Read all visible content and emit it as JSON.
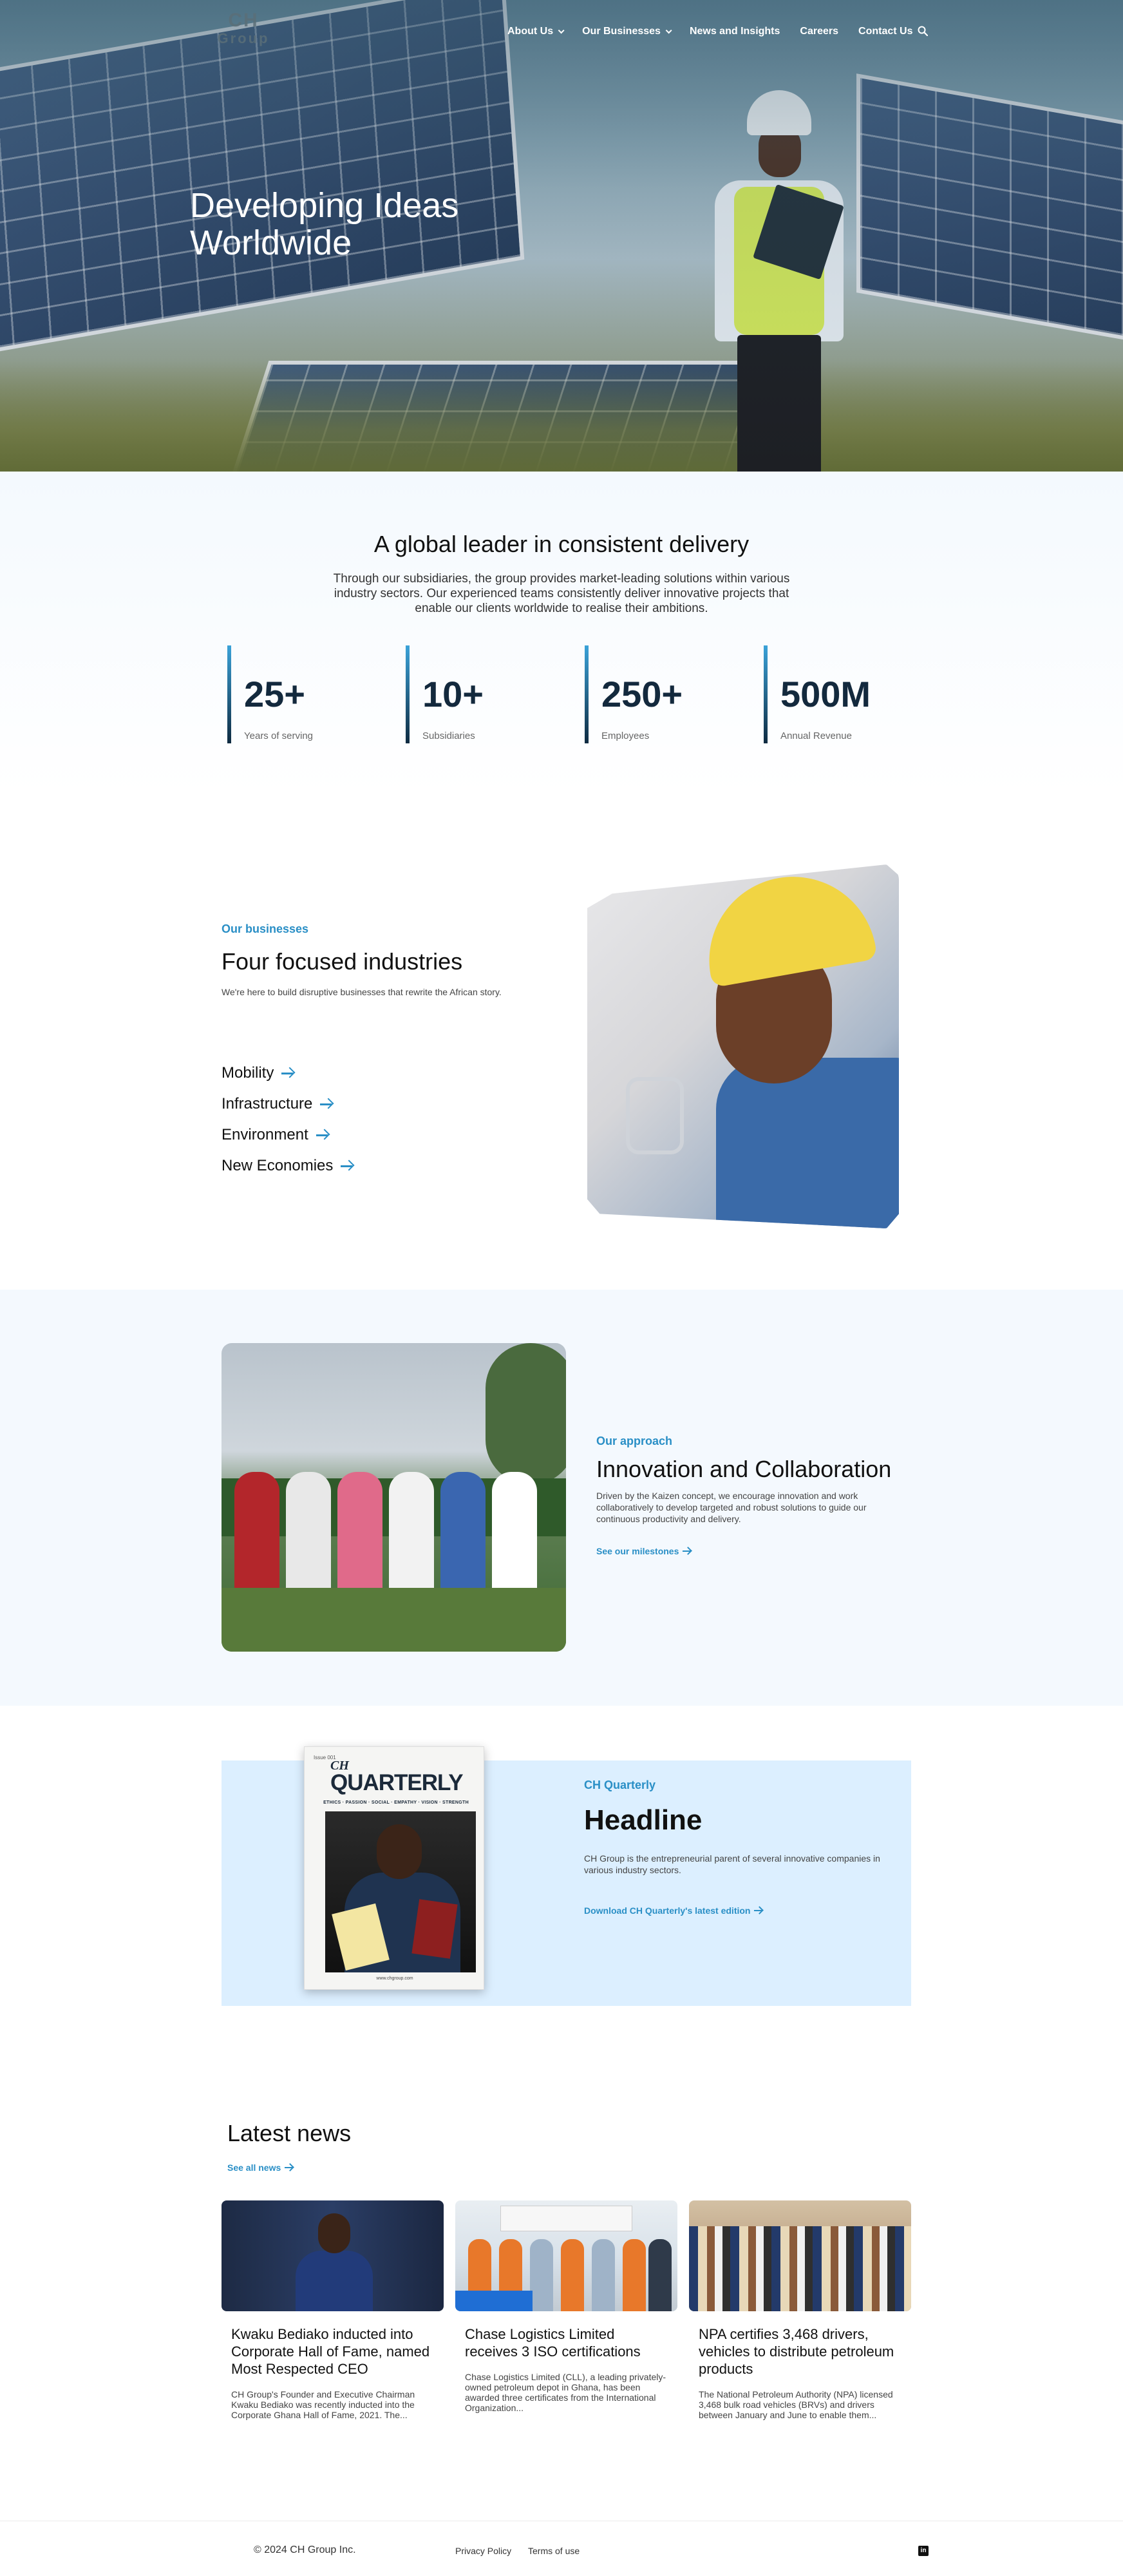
{
  "brand": {
    "logo_line1": "CH",
    "logo_line2": "Group"
  },
  "nav": {
    "items": [
      {
        "label": "About Us",
        "has_dropdown": true
      },
      {
        "label": "Our Businesses",
        "has_dropdown": true
      },
      {
        "label": "News and Insights",
        "has_dropdown": false
      },
      {
        "label": "Careers",
        "has_dropdown": false
      },
      {
        "label": "Contact Us",
        "has_dropdown": false
      }
    ],
    "search_icon": "search-icon"
  },
  "hero": {
    "title_line1": "Developing Ideas",
    "title_line2": "Worldwide"
  },
  "stats": {
    "title": "A global leader in consistent delivery",
    "lead": "Through our subsidiaries, the group provides market-leading solutions within various industry sectors. Our experienced teams consistently deliver innovative projects that enable our clients worldwide to realise their ambitions.",
    "items": [
      {
        "value": "25+",
        "label": "Years of serving"
      },
      {
        "value": "10+",
        "label": "Subsidiaries"
      },
      {
        "value": "250+",
        "label": "Employees"
      },
      {
        "value": "500M",
        "label": "Annual Revenue"
      }
    ]
  },
  "businesses": {
    "eyebrow": "Our businesses",
    "title": "Four focused industries",
    "subtitle": "We're here to build disruptive businesses that rewrite the African story.",
    "links": [
      "Mobility",
      "Infrastructure",
      "Environment",
      "New Economies"
    ]
  },
  "approach": {
    "eyebrow": "Our approach",
    "title": "Innovation and Collaboration",
    "subtitle": "Driven by the Kaizen concept, we encourage innovation and work collaboratively to develop targeted and robust solutions to guide our continuous productivity and delivery.",
    "cta": "See our milestones"
  },
  "quarterly": {
    "eyebrow": "CH Quarterly",
    "title": "Headline",
    "subtitle": "CH Group is the entrepreneurial parent of several innovative companies in various industry sectors.",
    "cta": "Download CH Quarterly's latest edition",
    "magazine": {
      "issue": "Issue 001",
      "brand": "CH",
      "name": "QUARTERLY",
      "tagline": "ETHICS · PASSION · SOCIAL · EMPATHY · VISION · STRENGTH",
      "footer": "www.chgroup.com"
    }
  },
  "news": {
    "title": "Latest news",
    "see_all": "See all news",
    "cards": [
      {
        "title": "Kwaku Bediako inducted into Corporate Hall of Fame, named Most Respected CEO",
        "excerpt": "CH Group's Founder and Executive Chairman Kwaku Bediako was recently inducted into the Corporate Ghana Hall of Fame, 2021. The..."
      },
      {
        "title": "Chase Logistics Limited receives 3 ISO certifications",
        "excerpt": "Chase Logistics Limited (CLL), a leading privately-owned petroleum depot in Ghana, has been awarded three certificates from the International Organization..."
      },
      {
        "title": "NPA certifies 3,468 drivers, vehicles to distribute petroleum products",
        "excerpt": "The National Petroleum Authority (NPA) licensed 3,468 bulk road vehicles (BRVs) and drivers between January and June to enable them..."
      }
    ]
  },
  "footer": {
    "copyright": "© 2024 CH Group Inc.",
    "privacy": "Privacy Policy",
    "terms": "Terms of use",
    "social_icon": "linkedin-icon",
    "social_glyph": "in"
  },
  "colors": {
    "accent": "#2a8fc6",
    "navy": "#13293d",
    "light_bg": "#f4f9fe",
    "quarterly_bg": "#dcefff"
  }
}
